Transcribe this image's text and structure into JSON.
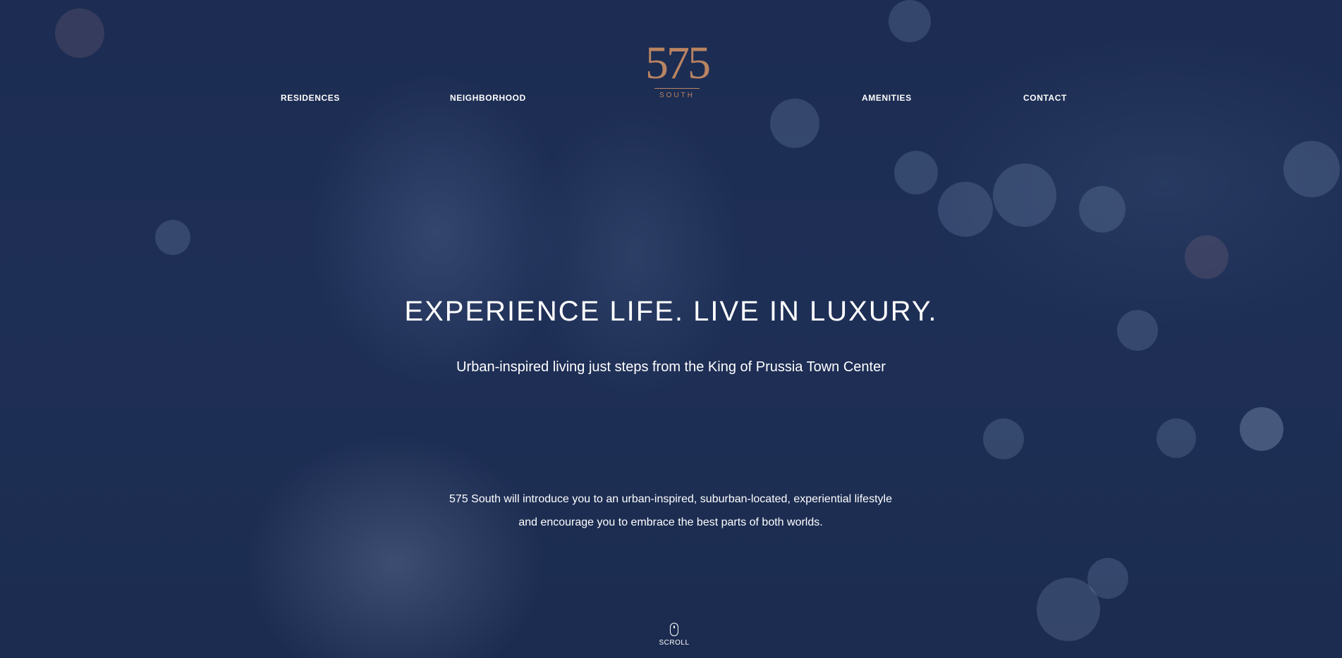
{
  "nav": {
    "left_links": [
      "RESIDENCES",
      "NEIGHBORHOOD"
    ],
    "right_links": [
      "AMENITIES",
      "CONTACT"
    ]
  },
  "logo": {
    "number": "575",
    "word": "SOUTH",
    "color": "#b98462"
  },
  "hero": {
    "headline": "EXPERIENCE LIFE. LIVE IN LUXURY.",
    "subheadline": "Urban-inspired living just steps from the King of Prussia Town Center",
    "body_line_1": "575 South will introduce you to an urban-inspired, suburban-located, experiential lifestyle",
    "body_line_2": "and encourage you to embrace the best parts of both worlds.",
    "overlay_color": "#1c2c52"
  },
  "scroll": {
    "label": "SCROLL",
    "icon": "mouse-icon"
  }
}
